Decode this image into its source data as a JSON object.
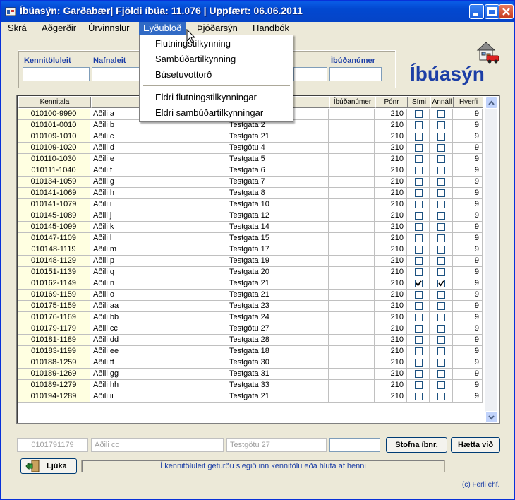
{
  "window": {
    "title": "Íbúasýn: Garðabær| Fjöldi íbúa: 11.076 | Uppfært: 06.06.2011"
  },
  "menu": [
    {
      "label": "Skrá"
    },
    {
      "label": "Aðgerðir"
    },
    {
      "label": "Úrvinnslur"
    },
    {
      "label": "Eyðublöð"
    },
    {
      "label": "Þjóðarsýn"
    },
    {
      "label": "Handbók"
    }
  ],
  "dropdown": {
    "items": [
      "Flutningstilkynning",
      "Sambúðartilkynning",
      "Búsetuvottorð"
    ],
    "items2": [
      "Eldri flutningstilkynningar",
      "Eldri sambúðartilkynningar"
    ]
  },
  "filter": {
    "kennitala_label": "Kennitöluleit",
    "nafn_label": "Nafnaleit",
    "ibudanumer_label": "Íbúðanúmer"
  },
  "app_title": "Íbúasýn",
  "grid": {
    "columns": [
      "Kennitala",
      "",
      "",
      "Íbúðanúmer",
      "Pónr",
      "Sími",
      "Annáll",
      "Hverfi"
    ],
    "rows": [
      {
        "k": "010100-9990",
        "n": "Aðili a",
        "a": "",
        "pn": "210",
        "s": false,
        "an": false,
        "h": "9"
      },
      {
        "k": "010101-0010",
        "n": "Aðili b",
        "a": "Testgata 2",
        "pn": "210",
        "s": false,
        "an": false,
        "h": "9"
      },
      {
        "k": "010109-1010",
        "n": "Aðili c",
        "a": "Testgata 21",
        "pn": "210",
        "s": false,
        "an": false,
        "h": "9"
      },
      {
        "k": "010109-1020",
        "n": "Aðili d",
        "a": "Testgötu 4",
        "pn": "210",
        "s": false,
        "an": false,
        "h": "9"
      },
      {
        "k": "010110-1030",
        "n": "Aðili e",
        "a": "Testgata 5",
        "pn": "210",
        "s": false,
        "an": false,
        "h": "9"
      },
      {
        "k": "010111-1040",
        "n": "Aðili f",
        "a": "Testgata 6",
        "pn": "210",
        "s": false,
        "an": false,
        "h": "9"
      },
      {
        "k": "010134-1059",
        "n": "Aðili g",
        "a": "Testgata 7",
        "pn": "210",
        "s": false,
        "an": false,
        "h": "9"
      },
      {
        "k": "010141-1069",
        "n": "Aðili h",
        "a": "Testgata 8",
        "pn": "210",
        "s": false,
        "an": false,
        "h": "9"
      },
      {
        "k": "010141-1079",
        "n": "Aðili i",
        "a": "Testgata 10",
        "pn": "210",
        "s": false,
        "an": false,
        "h": "9"
      },
      {
        "k": "010145-1089",
        "n": "Aðili j",
        "a": "Testgata 12",
        "pn": "210",
        "s": false,
        "an": false,
        "h": "9"
      },
      {
        "k": "010145-1099",
        "n": "Aðili k",
        "a": "Testgata 14",
        "pn": "210",
        "s": false,
        "an": false,
        "h": "9"
      },
      {
        "k": "010147-1109",
        "n": "Aðili l",
        "a": "Testgata 15",
        "pn": "210",
        "s": false,
        "an": false,
        "h": "9"
      },
      {
        "k": "010148-1119",
        "n": "Aðili m",
        "a": "Testgata 17",
        "pn": "210",
        "s": false,
        "an": false,
        "h": "9"
      },
      {
        "k": "010148-1129",
        "n": "Aðili p",
        "a": "Testgata 19",
        "pn": "210",
        "s": false,
        "an": false,
        "h": "9"
      },
      {
        "k": "010151-1139",
        "n": "Aðili q",
        "a": "Testgata 20",
        "pn": "210",
        "s": false,
        "an": false,
        "h": "9"
      },
      {
        "k": "010162-1149",
        "n": "Aðili n",
        "a": "Testgata 21",
        "pn": "210",
        "s": true,
        "an": true,
        "h": "9"
      },
      {
        "k": "010169-1159",
        "n": "Aðili o",
        "a": "Testgata 21",
        "pn": "210",
        "s": false,
        "an": false,
        "h": "9"
      },
      {
        "k": "010175-1159",
        "n": "Aðili aa",
        "a": "Testgata 23",
        "pn": "210",
        "s": false,
        "an": false,
        "h": "9"
      },
      {
        "k": "010176-1169",
        "n": "Aðili bb",
        "a": "Testgata 24",
        "pn": "210",
        "s": false,
        "an": false,
        "h": "9"
      },
      {
        "k": "010179-1179",
        "n": "Aðili cc",
        "a": "Testgötu 27",
        "pn": "210",
        "s": false,
        "an": false,
        "h": "9"
      },
      {
        "k": "010181-1189",
        "n": "Aðili dd",
        "a": "Testgata 28",
        "pn": "210",
        "s": false,
        "an": false,
        "h": "9"
      },
      {
        "k": "010183-1199",
        "n": "Aðili ee",
        "a": "Testgata 18",
        "pn": "210",
        "s": false,
        "an": false,
        "h": "9"
      },
      {
        "k": "010188-1259",
        "n": "Aðili ff",
        "a": "Testgata 30",
        "pn": "210",
        "s": false,
        "an": false,
        "h": "9"
      },
      {
        "k": "010189-1269",
        "n": "Aðili gg",
        "a": "Testgata 31",
        "pn": "210",
        "s": false,
        "an": false,
        "h": "9"
      },
      {
        "k": "010189-1279",
        "n": "Aðili hh",
        "a": "Testgata 33",
        "pn": "210",
        "s": false,
        "an": false,
        "h": "9"
      },
      {
        "k": "010194-1289",
        "n": "Aðili ii",
        "a": "Testgata 21",
        "pn": "210",
        "s": false,
        "an": false,
        "h": "9"
      }
    ]
  },
  "bottom": {
    "kennitala": "0101791179",
    "nafn": "Aðili cc",
    "heimili": "Testgötu 27",
    "ibudanumer": "",
    "stofna_label": "Stofna íbnr.",
    "haetta_label": "Hætta við",
    "ljuka_label": "Ljúka",
    "status": "Í kennitöluleit geturðu slegið inn kennitölu eða hluta af henni",
    "copyright": "(c) Ferli ehf."
  },
  "colors": {
    "titlebar": "#0548d0",
    "accent_text": "#1c3ea6",
    "menu_highlight": "#316ac5",
    "kennitala_bg": "#ffffe1"
  }
}
